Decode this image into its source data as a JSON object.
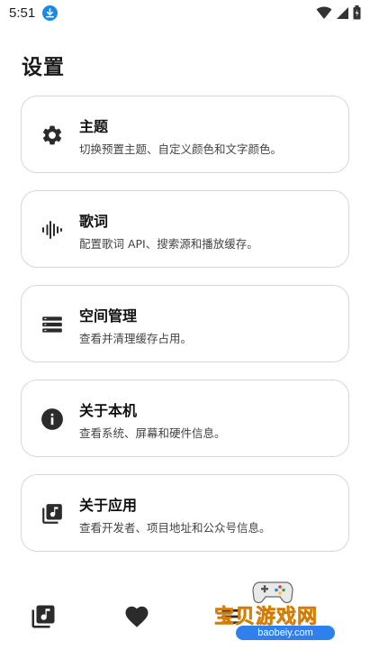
{
  "status_bar": {
    "time": "5:51",
    "download_icon": "download-icon",
    "wifi_icon": "wifi-icon",
    "signal_icon": "signal-icon",
    "battery_icon": "battery-charging-icon"
  },
  "header": {
    "title": "设置"
  },
  "settings": [
    {
      "title": "主题",
      "subtitle": "切换预置主题、自定义颜色和文字颜色。",
      "icon": "gear-icon"
    },
    {
      "title": "歌词",
      "subtitle": "配置歌词 API、搜索源和播放缓存。",
      "icon": "waveform-icon"
    },
    {
      "title": "空间管理",
      "subtitle": "查看并清理缓存占用。",
      "icon": "storage-icon"
    },
    {
      "title": "关于本机",
      "subtitle": "查看系统、屏幕和硬件信息。",
      "icon": "info-icon"
    },
    {
      "title": "关于应用",
      "subtitle": "查看开发者、项目地址和公众号信息。",
      "icon": "music-library-icon"
    }
  ],
  "bottom_nav": [
    {
      "icon": "music-library-icon"
    },
    {
      "icon": "heart-icon"
    },
    {
      "icon": "menu-icon"
    }
  ],
  "watermark": {
    "title": "宝贝游戏网",
    "url": "baobeiy.com"
  },
  "colors": {
    "background": "#ffffff",
    "card_border": "#d7d7d7",
    "icon": "#2b2b2b",
    "download_badge": "#1e88e5",
    "watermark": "#f5a623"
  }
}
